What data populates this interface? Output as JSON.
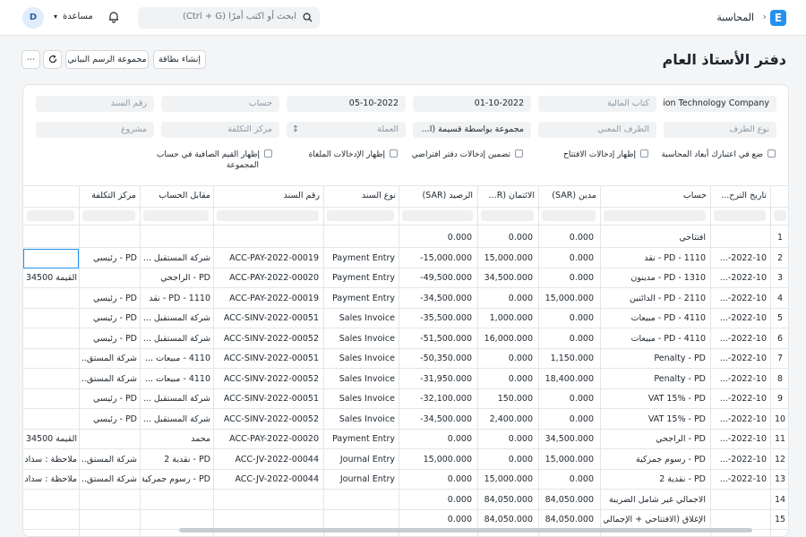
{
  "navbar": {
    "logo_letter": "E",
    "breadcrumb": "المحاسبة",
    "search_placeholder": "ابحث أو اكتب أمرًا (Ctrl + G)",
    "help_label": "مساعدة",
    "avatar_letter": "D"
  },
  "page": {
    "title": "دفتر الأستاذ العام",
    "buttons": {
      "create_card": "إنشاء بطاقة",
      "chart_group": "مجموعة الرسم البياني",
      "more": "⋯"
    }
  },
  "filters": {
    "company": "tion Technology Company",
    "finance_book_placeholder": "كتاب المالية",
    "from_date": "01-10-2022",
    "to_date": "05-10-2022",
    "account_placeholder": "حساب",
    "voucher_no_placeholder": "رقم السند",
    "party_type_placeholder": "نوع الطرف",
    "party_placeholder": "الطرف المعني",
    "group_by": "مجموعة بواسطة قسيمة (ا...",
    "currency_placeholder": "العملة",
    "cost_center_placeholder": "مركز التكلفة",
    "project_placeholder": "مشروع",
    "checks": {
      "accounting_dimensions": "ضع في اعتبارك أبعاد المحاسبة",
      "opening_entries": "إظهار إدخالات الافتتاح",
      "default_book": "تضمين إدخالات دفتر افتراضي",
      "cancelled": "إظهار الإدخالات الملغاة",
      "net_values_line1": "إظهار القيم الصافية في حساب",
      "net_values_line2": "المجموعة"
    }
  },
  "table": {
    "headers": {
      "posting_date": "تاريخ الترح...",
      "account": "حساب",
      "debit": "مدين (SAR)",
      "credit": "الائتمان (R...",
      "balance": "الرصيد (SAR)",
      "voucher_type": "نوع السند",
      "voucher_no": "رقم السند",
      "against_account": "مقابل الحساب",
      "cost_center": "مركز التكلفة"
    },
    "rows": [
      {
        "n": "1",
        "date": "",
        "account": "افتتاحي",
        "debit": "0.000",
        "credit": "0.000",
        "balance": "0.000",
        "vtype": "",
        "vno": "",
        "against": "",
        "cc": "",
        "extra": ""
      },
      {
        "n": "2",
        "date": "2022-10-...",
        "account": "PD - 1110 - نقد",
        "debit": "0.000",
        "credit": "15,000.000",
        "balance": "-15,000.000",
        "vtype": "Payment Entry",
        "vno": "ACC-PAY-2022-00019",
        "against": "شركة المستقبل ...",
        "cc": "PD - رئيسي",
        "extra": ""
      },
      {
        "n": "3",
        "date": "2022-10-...",
        "account": "PD - 1310 - مدينون",
        "debit": "0.000",
        "credit": "34,500.000",
        "balance": "-49,500.000",
        "vtype": "Payment Entry",
        "vno": "ACC-PAY-2022-00020",
        "against": "PD - الراجحي",
        "cc": "",
        "extra": "القيمة 34500"
      },
      {
        "n": "4",
        "date": "2022-10-...",
        "account": "PD - 2110 - الدائنين",
        "debit": "15,000.000",
        "credit": "0.000",
        "balance": "-34,500.000",
        "vtype": "Payment Entry",
        "vno": "ACC-PAY-2022-00019",
        "against": "PD - 1110 - نقد",
        "cc": "PD - رئيسي",
        "extra": ""
      },
      {
        "n": "5",
        "date": "2022-10-...",
        "account": "PD - 4110 - مبيعات",
        "debit": "0.000",
        "credit": "1,000.000",
        "balance": "-35,500.000",
        "vtype": "Sales Invoice",
        "vno": "ACC-SINV-2022-00051",
        "against": "شركة المستقبل ...",
        "cc": "PD - رئيسي",
        "extra": ""
      },
      {
        "n": "6",
        "date": "2022-10-...",
        "account": "PD - 4110 - مبيعات",
        "debit": "0.000",
        "credit": "16,000.000",
        "balance": "-51,500.000",
        "vtype": "Sales Invoice",
        "vno": "ACC-SINV-2022-00052",
        "against": "شركة المستقبل ...",
        "cc": "PD - رئيسي",
        "extra": ""
      },
      {
        "n": "7",
        "date": "2022-10-...",
        "account": "Penalty - PD",
        "debit": "1,150.000",
        "credit": "0.000",
        "balance": "-50,350.000",
        "vtype": "Sales Invoice",
        "vno": "ACC-SINV-2022-00051",
        "against": "4110 - مبيعات ...",
        "cc": "شركة المستق...",
        "extra": ""
      },
      {
        "n": "8",
        "date": "2022-10-...",
        "account": "Penalty - PD",
        "debit": "18,400.000",
        "credit": "0.000",
        "balance": "-31,950.000",
        "vtype": "Sales Invoice",
        "vno": "ACC-SINV-2022-00052",
        "against": "4110 - مبيعات ...",
        "cc": "شركة المستق...",
        "extra": ""
      },
      {
        "n": "9",
        "date": "2022-10-...",
        "account": "VAT 15% - PD",
        "debit": "0.000",
        "credit": "150.000",
        "balance": "-32,100.000",
        "vtype": "Sales Invoice",
        "vno": "ACC-SINV-2022-00051",
        "against": "شركة المستقبل ...",
        "cc": "PD - رئيسي",
        "extra": ""
      },
      {
        "n": "10",
        "date": "2022-10-...",
        "account": "VAT 15% - PD",
        "debit": "0.000",
        "credit": "2,400.000",
        "balance": "-34,500.000",
        "vtype": "Sales Invoice",
        "vno": "ACC-SINV-2022-00052",
        "against": "شركة المستقبل ...",
        "cc": "PD - رئيسي",
        "extra": ""
      },
      {
        "n": "11",
        "date": "2022-10-...",
        "account": "PD - الراجحي",
        "debit": "34,500.000",
        "credit": "0.000",
        "balance": "0.000",
        "vtype": "Payment Entry",
        "vno": "ACC-PAY-2022-00020",
        "against": "محمد",
        "cc": "",
        "extra": "القيمة 34500"
      },
      {
        "n": "12",
        "date": "2022-10-...",
        "account": "PD - رسوم جمركية",
        "debit": "15,000.000",
        "credit": "0.000",
        "balance": "15,000.000",
        "vtype": "Journal Entry",
        "vno": "ACC-JV-2022-00044",
        "against": "PD - نقدية 2",
        "cc": "شركة المستق...",
        "extra": "ملاحظة : سداد"
      },
      {
        "n": "13",
        "date": "2022-10-...",
        "account": "PD - نقدية 2",
        "debit": "0.000",
        "credit": "15,000.000",
        "balance": "0.000",
        "vtype": "Journal Entry",
        "vno": "ACC-JV-2022-00044",
        "against": "PD - رسوم جمركية",
        "cc": "شركة المستق...",
        "extra": "ملاحظة : سداد"
      },
      {
        "n": "14",
        "date": "",
        "account": "الاجمالي غير شامل الضريبة",
        "debit": "84,050.000",
        "credit": "84,050.000",
        "balance": "0.000",
        "vtype": "",
        "vno": "",
        "against": "",
        "cc": "",
        "extra": ""
      },
      {
        "n": "15",
        "date": "",
        "account": "الإغلاق (الافتتاحي + الإجمالي)",
        "debit": "84,050.000",
        "credit": "84,050.000",
        "balance": "0.000",
        "vtype": "",
        "vno": "",
        "against": "",
        "cc": "",
        "extra": ""
      }
    ]
  }
}
